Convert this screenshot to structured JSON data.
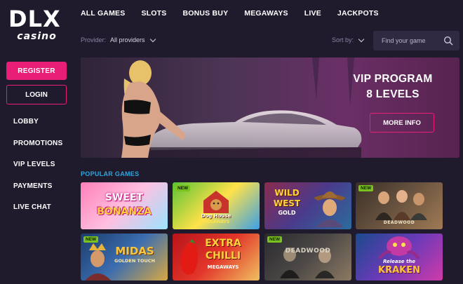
{
  "logo": {
    "main": "DLX",
    "sub": "casino"
  },
  "sidebar": {
    "register_label": "REGISTER",
    "login_label": "LOGIN",
    "items": [
      {
        "label": "LOBBY"
      },
      {
        "label": "PROMOTIONS"
      },
      {
        "label": "VIP LEVELS"
      },
      {
        "label": "PAYMENTS"
      },
      {
        "label": "LIVE CHAT"
      }
    ]
  },
  "topnav": {
    "items": [
      {
        "label": "ALL GAMES"
      },
      {
        "label": "SLOTS"
      },
      {
        "label": "BONUS BUY"
      },
      {
        "label": "MEGAWAYS"
      },
      {
        "label": "LIVE"
      },
      {
        "label": "JACKPOTS"
      }
    ]
  },
  "filters": {
    "provider_label": "Provider:",
    "provider_value": "All providers",
    "sort_label": "Sort by:"
  },
  "search": {
    "placeholder": "Find your game"
  },
  "banner": {
    "title_line1": "VIP PROGRAM",
    "title_line2": "8 LEVELS",
    "button_label": "MORE INFO"
  },
  "popular": {
    "title": "POPULAR GAMES",
    "new_badge": "NEW",
    "games": [
      {
        "title": "SWEET BONANZA",
        "title_line1": "SWEET",
        "title_line2": "BONANZA",
        "new": false,
        "colors": [
          "#ff7fb8",
          "#ffc0e0",
          "#9be3ff"
        ]
      },
      {
        "title": "DOG HOUSE MEGAWAYS",
        "title_line1": "Dog House",
        "title_line2": "MEGAWAYS",
        "new": true,
        "colors": [
          "#5bc236",
          "#ffe24a",
          "#3aa0e8"
        ]
      },
      {
        "title": "WILD WEST GOLD",
        "title_line1": "WILD",
        "title_line2": "WEST",
        "title_line3": "GOLD",
        "new": false,
        "colors": [
          "#8a2b4e",
          "#4b3a8a",
          "#2b6c9e"
        ]
      },
      {
        "title": "DEADWOOD",
        "title_line1": "DEADWOOD",
        "new": true,
        "colors": [
          "#3a3028",
          "#6a5440",
          "#a07a54"
        ]
      },
      {
        "title": "MIDAS GOLDEN TOUCH",
        "title_line1": "MIDAS",
        "title_line2": "GOLDEN TOUCH",
        "new": true,
        "colors": [
          "#1c3c6a",
          "#3b6db0",
          "#d9a842"
        ]
      },
      {
        "title": "EXTRA CHILLI MEGAWAYS",
        "title_line1": "EXTRA",
        "title_line2": "CHILLI",
        "title_line3": "MEGAWAYS",
        "new": false,
        "colors": [
          "#b8141a",
          "#e2352a",
          "#f0c060"
        ]
      },
      {
        "title": "DEADWOOD",
        "title_line1": "DEADWOOD",
        "new": true,
        "colors": [
          "#2a2a2e",
          "#4c4846",
          "#8b7a62"
        ]
      },
      {
        "title": "Release the KRAKEN",
        "title_line1": "Release the",
        "title_line2": "KRAKEN",
        "new": false,
        "colors": [
          "#1a4a8c",
          "#6b3ab8",
          "#d03aa8"
        ]
      }
    ]
  },
  "colors": {
    "accent": "#e91e77",
    "section": "#2aa7e0",
    "background": "#1f1b2d",
    "new_badge": "#7ac21d"
  }
}
